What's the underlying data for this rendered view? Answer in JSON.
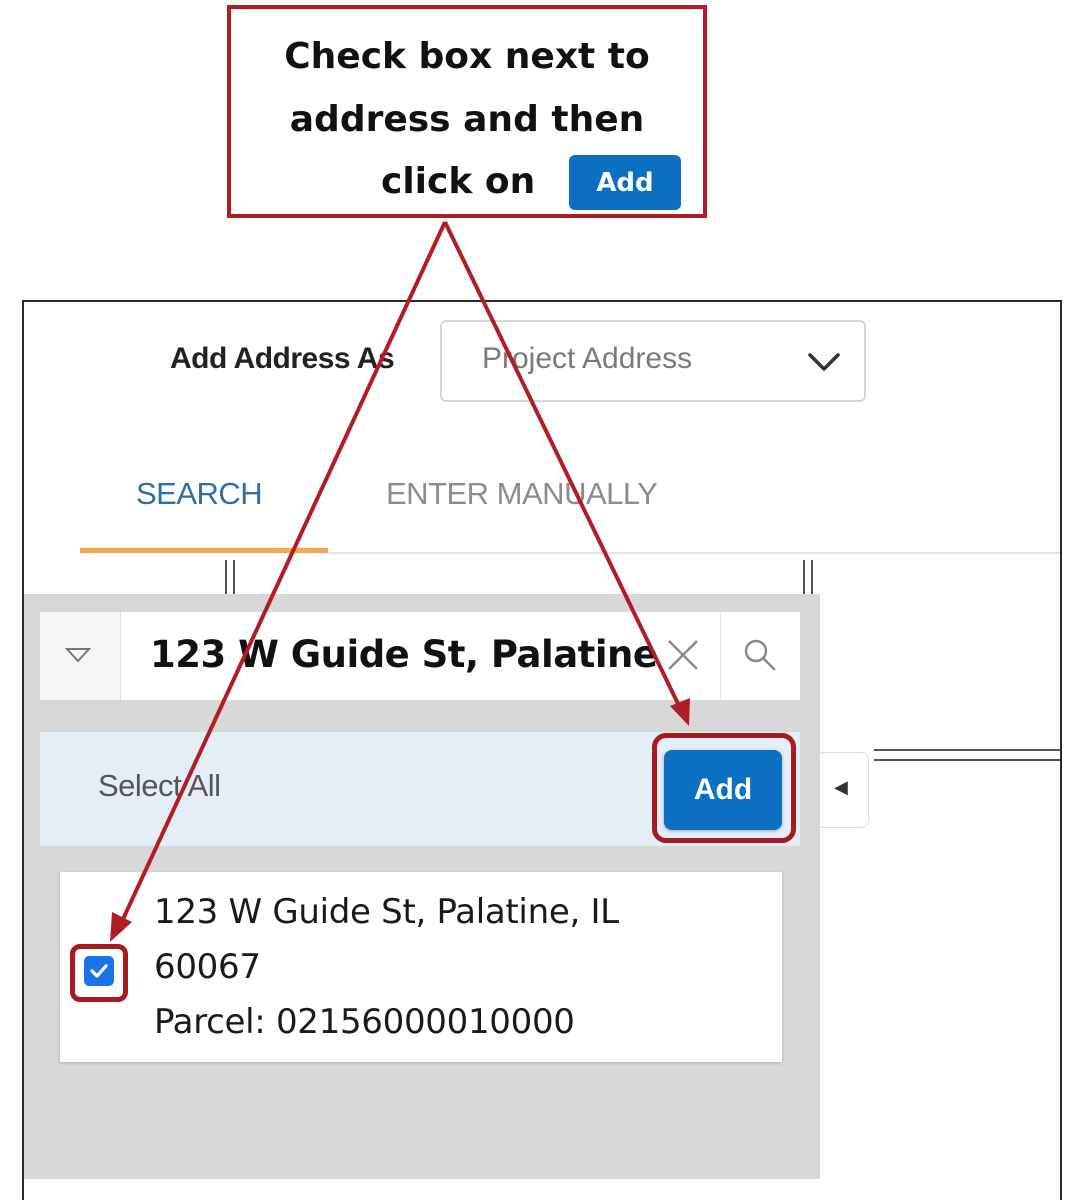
{
  "callout": {
    "line1": "Check box next to",
    "line2": "address and then",
    "line3": "click on",
    "button_label": "Add"
  },
  "form": {
    "add_address_as_label": "Add Address As",
    "add_address_as_value": "Project Address"
  },
  "tabs": [
    {
      "label": "SEARCH",
      "active": true
    },
    {
      "label": "ENTER MANUALLY",
      "active": false
    }
  ],
  "search": {
    "value": "123 W Guide St, Palatine"
  },
  "results": {
    "select_all_label": "Select All",
    "add_button_label": "Add",
    "items": [
      {
        "address_line1": "123 W Guide St, Palatine, IL",
        "address_line2": "60067",
        "parcel": "Parcel: 02156000010000",
        "checked": true
      }
    ]
  },
  "colors": {
    "annotation_red": "#b01e23",
    "button_blue": "#0b6fc2",
    "tab_active": "#2f6fa8",
    "tab_underline": "#f3a94e",
    "select_all_bg": "#e5eef6",
    "checkbox_blue": "#1a73e8"
  },
  "icons": {
    "dropdown": "chevron-down-icon",
    "search_dropdown": "triangle-down-icon",
    "clear": "close-icon",
    "search": "search-icon",
    "collapse": "caret-left-icon",
    "checkbox": "checkmark-icon"
  }
}
